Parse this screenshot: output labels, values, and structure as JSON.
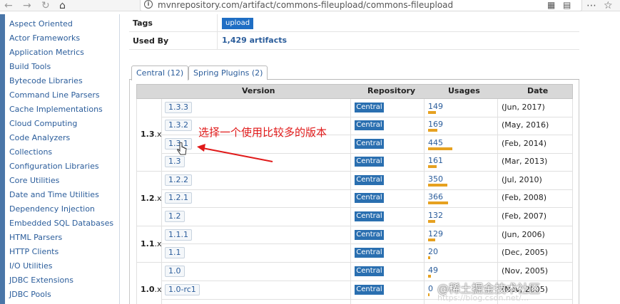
{
  "browser": {
    "url": "mvnrepository.com/artifact/commons-fileupload/commons-fileupload",
    "back_icon": "←",
    "forward_icon": "→",
    "reload_icon": "↻",
    "home_icon": "⌂",
    "qr_icon": "▦",
    "reader_icon": "▤",
    "menu_icon": "⋯",
    "star_icon": "☆"
  },
  "sidebar": {
    "items": [
      "Aspect Oriented",
      "Actor Frameworks",
      "Application Metrics",
      "Build Tools",
      "Bytecode Libraries",
      "Command Line Parsers",
      "Cache Implementations",
      "Cloud Computing",
      "Code Analyzers",
      "Collections",
      "Configuration Libraries",
      "Core Utilities",
      "Date and Time Utilities",
      "Dependency Injection",
      "Embedded SQL Databases",
      "HTML Parsers",
      "HTTP Clients",
      "I/O Utilities",
      "JDBC Extensions",
      "JDBC Pools"
    ]
  },
  "info": {
    "tags_label": "Tags",
    "tag_value": "upload",
    "usedby_label": "Used By",
    "usedby_value": "1,429 artifacts"
  },
  "tabs": [
    {
      "label": "Central (12)",
      "active": true
    },
    {
      "label": "Spring Plugins (2)",
      "active": false
    }
  ],
  "table": {
    "headers": [
      "Version",
      "Repository",
      "Usages",
      "Date"
    ],
    "groups": [
      {
        "label_bold": "1.3",
        "label_rest": ".x"
      },
      {
        "label_bold": "1.2",
        "label_rest": ".x"
      },
      {
        "label_bold": "1.1",
        "label_rest": ".x"
      },
      {
        "label_bold": "1.0",
        "label_rest": ".x"
      }
    ],
    "rows": [
      {
        "version": "1.3.3",
        "repo": "Central",
        "usages": "149",
        "usage_level": 149,
        "date": "(Jun, 2017)"
      },
      {
        "version": "1.3.2",
        "repo": "Central",
        "usages": "169",
        "usage_level": 169,
        "date": "(May, 2016)"
      },
      {
        "version": "1.3.1",
        "repo": "Central",
        "usages": "445",
        "usage_level": 445,
        "date": "(Feb, 2014)"
      },
      {
        "version": "1.3",
        "repo": "Central",
        "usages": "161",
        "usage_level": 161,
        "date": "(Mar, 2013)"
      },
      {
        "version": "1.2.2",
        "repo": "Central",
        "usages": "350",
        "usage_level": 350,
        "date": "(Jul, 2010)"
      },
      {
        "version": "1.2.1",
        "repo": "Central",
        "usages": "366",
        "usage_level": 366,
        "date": "(Feb, 2008)"
      },
      {
        "version": "1.2",
        "repo": "Central",
        "usages": "132",
        "usage_level": 132,
        "date": "(Feb, 2007)"
      },
      {
        "version": "1.1.1",
        "repo": "Central",
        "usages": "129",
        "usage_level": 129,
        "date": "(Jun, 2006)"
      },
      {
        "version": "1.1",
        "repo": "Central",
        "usages": "20",
        "usage_level": 20,
        "date": "(Dec, 2005)"
      },
      {
        "version": "1.0",
        "repo": "Central",
        "usages": "49",
        "usage_level": 49,
        "date": "(Nov, 2005)"
      },
      {
        "version": "1.0-rc1",
        "repo": "Central",
        "usages": "0",
        "usage_level": 0,
        "date": "(Nov, 2005)"
      }
    ]
  },
  "annotation": {
    "text": "选择一个使用比较多的版本",
    "color": "#e01919"
  },
  "watermark": {
    "text": "@稀土掘金技术社区",
    "sub": "https://blog.csdn.net/..."
  },
  "colors": {
    "link": "#2b5d9b",
    "repo_badge": "#2a6fb0",
    "usage_bar": "#e6a120",
    "tag_badge": "#1f6ec4"
  }
}
